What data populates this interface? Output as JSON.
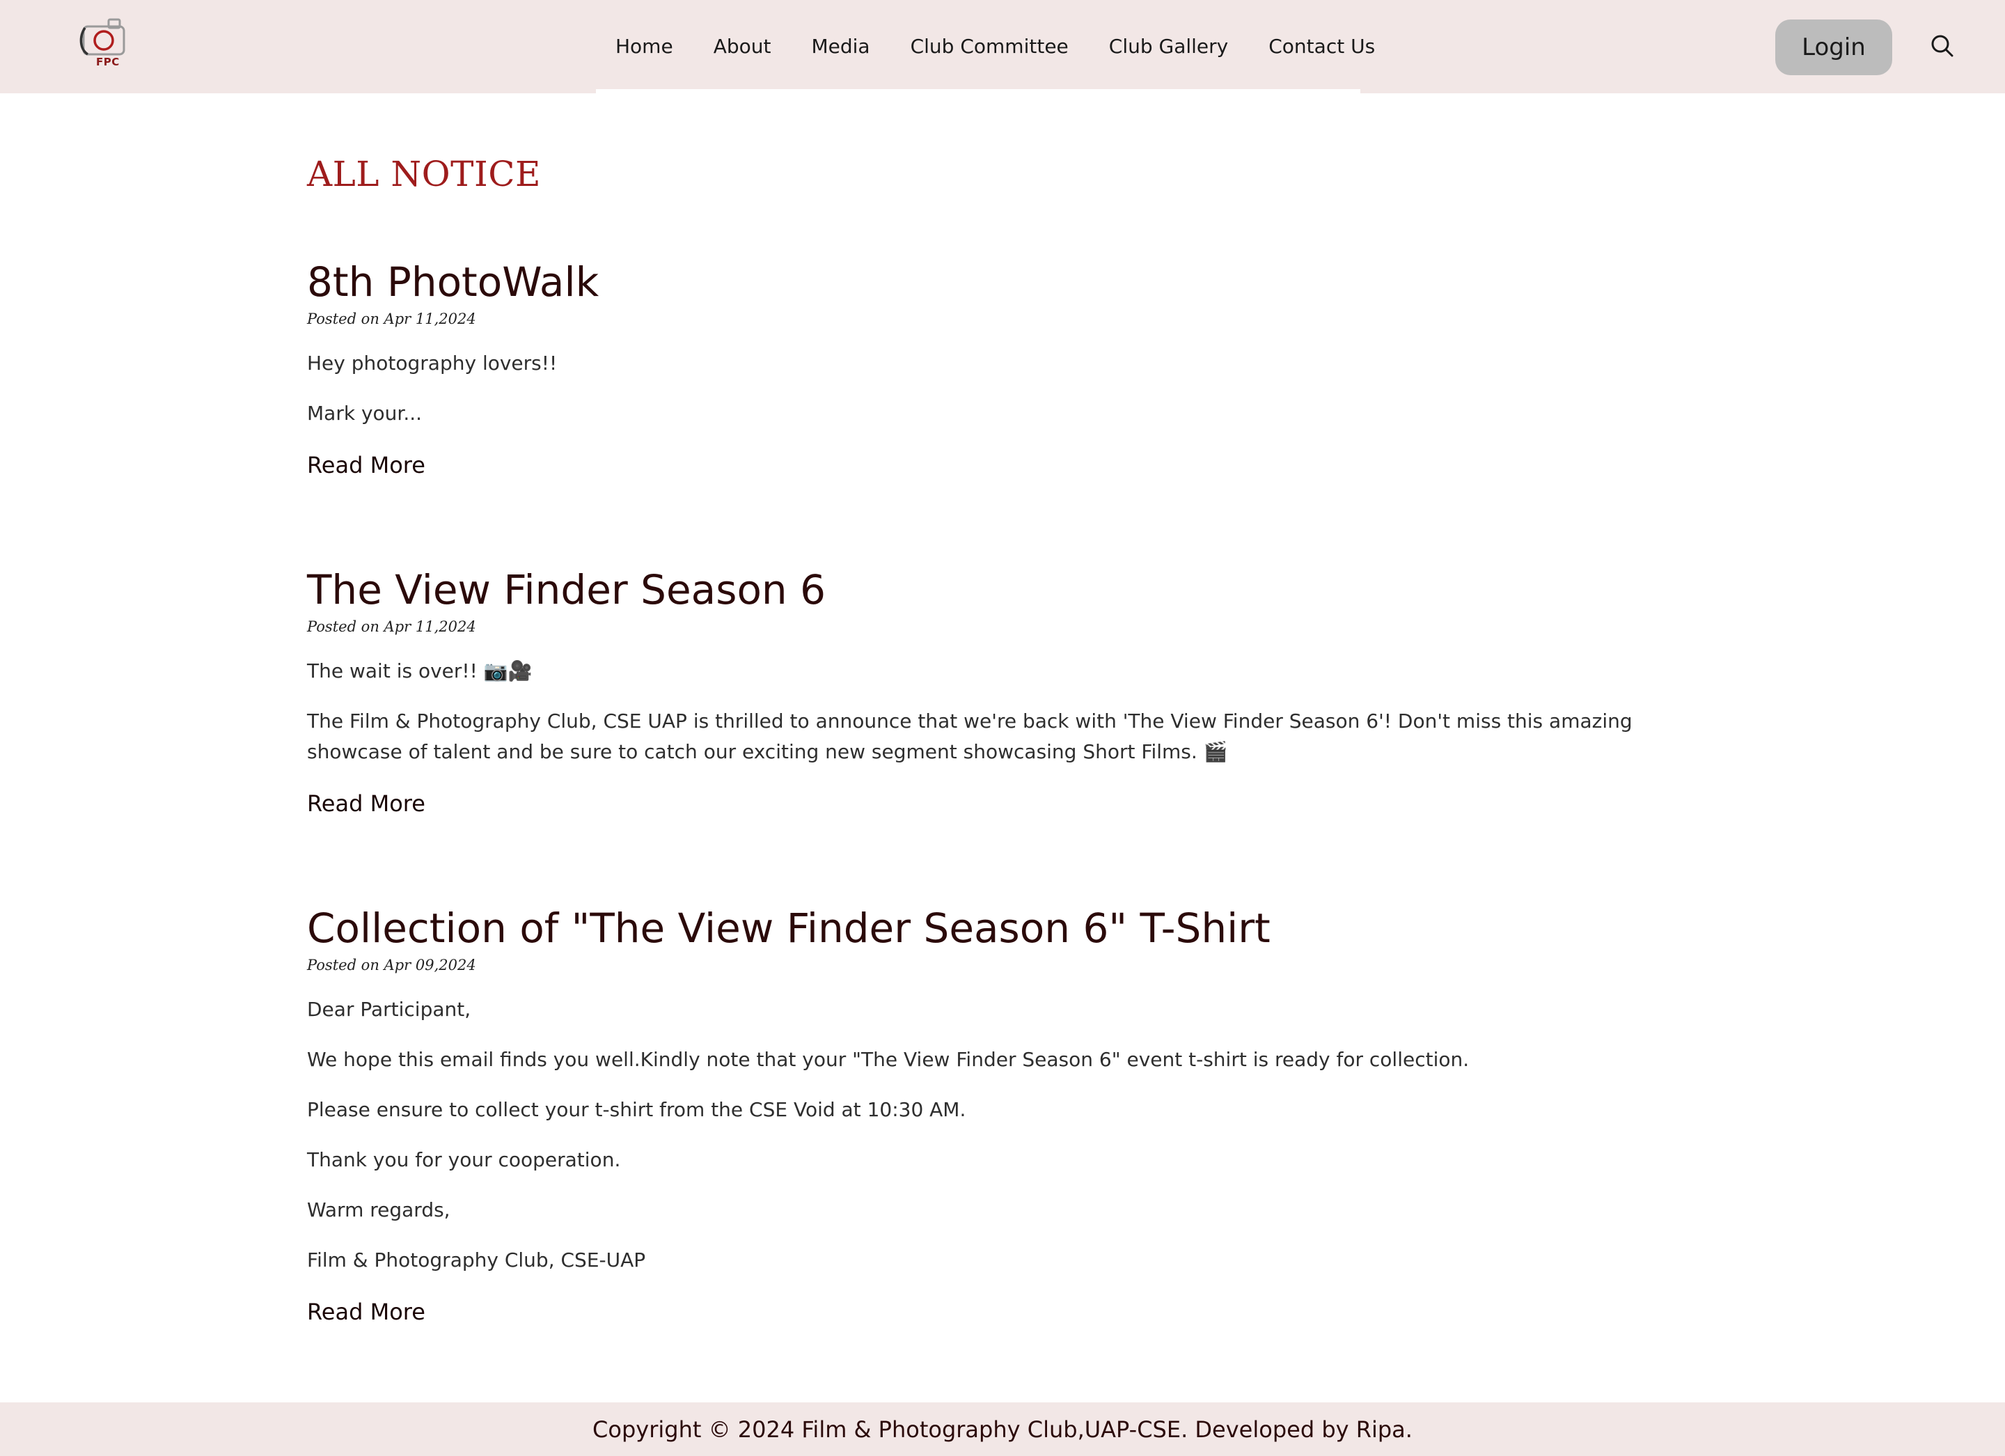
{
  "header": {
    "logo_text": "FPC",
    "nav": [
      "Home",
      "About",
      "Media",
      "Club Committee",
      "Club Gallery",
      "Contact Us"
    ],
    "login_label": "Login",
    "search_icon": "search-icon"
  },
  "main": {
    "title": "ALL NOTICE",
    "read_more_label": "Read More",
    "notices": [
      {
        "title": "8th PhotoWalk",
        "date": "Posted on Apr 11,2024",
        "paragraphs": [
          "Hey photography lovers!!",
          "Mark your..."
        ]
      },
      {
        "title": "The View Finder Season 6",
        "date": "Posted on Apr 11,2024",
        "paragraphs": [
          "The wait is over!! 📷🎥",
          "The Film & Photography Club, CSE UAP is thrilled to announce that we're back with 'The View Finder Season 6'! Don't miss this amazing showcase of talent and be sure to catch our exciting new segment showcasing Short Films. 🎬"
        ]
      },
      {
        "title": "Collection of \"The View Finder Season 6\" T-Shirt",
        "date": "Posted on Apr 09,2024",
        "paragraphs": [
          "Dear Participant,",
          "We hope this email finds you well.Kindly note that your \"The View Finder Season 6\" event t-shirt is ready for collection.",
          "Please ensure to collect your t-shirt from the CSE Void at 10:30 AM.",
          "Thank you for your cooperation.",
          "Warm regards,",
          "Film & Photography Club, CSE-UAP"
        ]
      }
    ]
  },
  "footer": {
    "text": "Copyright © 2024 Film & Photography Club,UAP-CSE. Developed by Ripa."
  },
  "colors": {
    "header_bg": "#f2e7e6",
    "title_red": "#9e1c1c",
    "heading_dark": "#2b0a0a",
    "login_bg": "#bcbcbc"
  }
}
